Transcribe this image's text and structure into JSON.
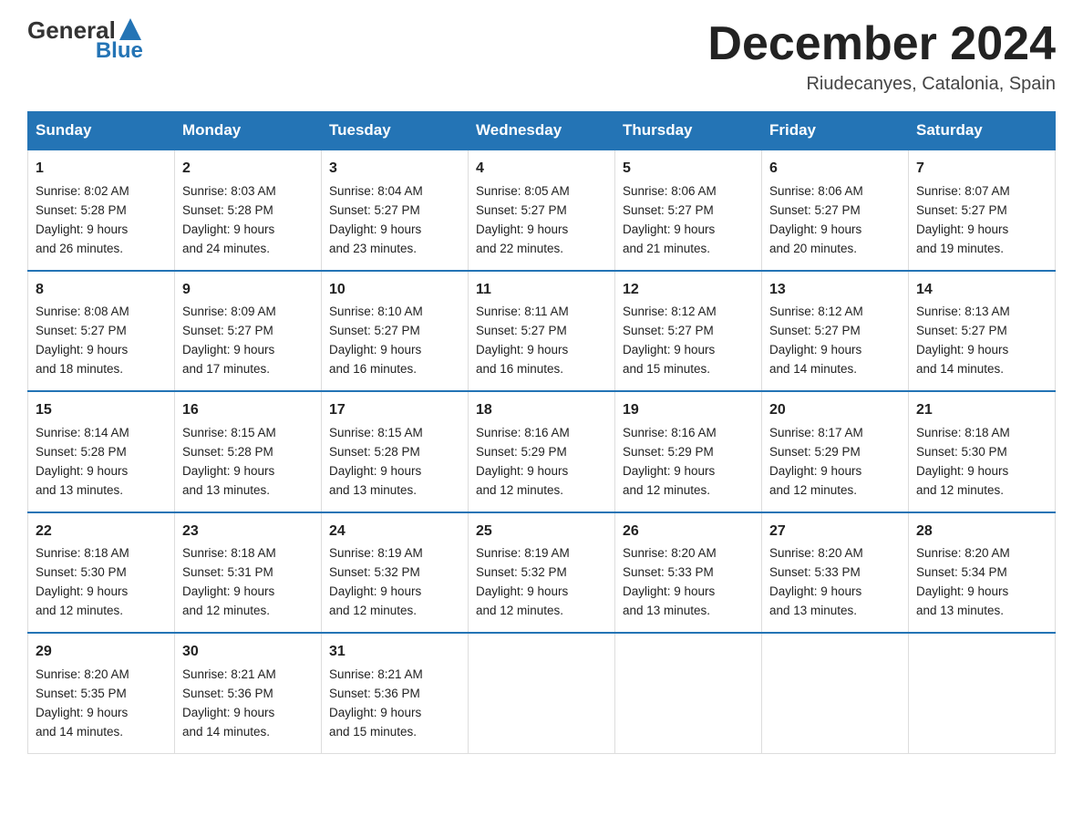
{
  "logo": {
    "general": "General",
    "blue": "Blue",
    "arrow": "▲"
  },
  "header": {
    "month": "December 2024",
    "location": "Riudecanyes, Catalonia, Spain"
  },
  "weekdays": [
    "Sunday",
    "Monday",
    "Tuesday",
    "Wednesday",
    "Thursday",
    "Friday",
    "Saturday"
  ],
  "weeks": [
    [
      {
        "day": "1",
        "sunrise": "8:02 AM",
        "sunset": "5:28 PM",
        "daylight": "9 hours and 26 minutes."
      },
      {
        "day": "2",
        "sunrise": "8:03 AM",
        "sunset": "5:28 PM",
        "daylight": "9 hours and 24 minutes."
      },
      {
        "day": "3",
        "sunrise": "8:04 AM",
        "sunset": "5:27 PM",
        "daylight": "9 hours and 23 minutes."
      },
      {
        "day": "4",
        "sunrise": "8:05 AM",
        "sunset": "5:27 PM",
        "daylight": "9 hours and 22 minutes."
      },
      {
        "day": "5",
        "sunrise": "8:06 AM",
        "sunset": "5:27 PM",
        "daylight": "9 hours and 21 minutes."
      },
      {
        "day": "6",
        "sunrise": "8:06 AM",
        "sunset": "5:27 PM",
        "daylight": "9 hours and 20 minutes."
      },
      {
        "day": "7",
        "sunrise": "8:07 AM",
        "sunset": "5:27 PM",
        "daylight": "9 hours and 19 minutes."
      }
    ],
    [
      {
        "day": "8",
        "sunrise": "8:08 AM",
        "sunset": "5:27 PM",
        "daylight": "9 hours and 18 minutes."
      },
      {
        "day": "9",
        "sunrise": "8:09 AM",
        "sunset": "5:27 PM",
        "daylight": "9 hours and 17 minutes."
      },
      {
        "day": "10",
        "sunrise": "8:10 AM",
        "sunset": "5:27 PM",
        "daylight": "9 hours and 16 minutes."
      },
      {
        "day": "11",
        "sunrise": "8:11 AM",
        "sunset": "5:27 PM",
        "daylight": "9 hours and 16 minutes."
      },
      {
        "day": "12",
        "sunrise": "8:12 AM",
        "sunset": "5:27 PM",
        "daylight": "9 hours and 15 minutes."
      },
      {
        "day": "13",
        "sunrise": "8:12 AM",
        "sunset": "5:27 PM",
        "daylight": "9 hours and 14 minutes."
      },
      {
        "day": "14",
        "sunrise": "8:13 AM",
        "sunset": "5:27 PM",
        "daylight": "9 hours and 14 minutes."
      }
    ],
    [
      {
        "day": "15",
        "sunrise": "8:14 AM",
        "sunset": "5:28 PM",
        "daylight": "9 hours and 13 minutes."
      },
      {
        "day": "16",
        "sunrise": "8:15 AM",
        "sunset": "5:28 PM",
        "daylight": "9 hours and 13 minutes."
      },
      {
        "day": "17",
        "sunrise": "8:15 AM",
        "sunset": "5:28 PM",
        "daylight": "9 hours and 13 minutes."
      },
      {
        "day": "18",
        "sunrise": "8:16 AM",
        "sunset": "5:29 PM",
        "daylight": "9 hours and 12 minutes."
      },
      {
        "day": "19",
        "sunrise": "8:16 AM",
        "sunset": "5:29 PM",
        "daylight": "9 hours and 12 minutes."
      },
      {
        "day": "20",
        "sunrise": "8:17 AM",
        "sunset": "5:29 PM",
        "daylight": "9 hours and 12 minutes."
      },
      {
        "day": "21",
        "sunrise": "8:18 AM",
        "sunset": "5:30 PM",
        "daylight": "9 hours and 12 minutes."
      }
    ],
    [
      {
        "day": "22",
        "sunrise": "8:18 AM",
        "sunset": "5:30 PM",
        "daylight": "9 hours and 12 minutes."
      },
      {
        "day": "23",
        "sunrise": "8:18 AM",
        "sunset": "5:31 PM",
        "daylight": "9 hours and 12 minutes."
      },
      {
        "day": "24",
        "sunrise": "8:19 AM",
        "sunset": "5:32 PM",
        "daylight": "9 hours and 12 minutes."
      },
      {
        "day": "25",
        "sunrise": "8:19 AM",
        "sunset": "5:32 PM",
        "daylight": "9 hours and 12 minutes."
      },
      {
        "day": "26",
        "sunrise": "8:20 AM",
        "sunset": "5:33 PM",
        "daylight": "9 hours and 13 minutes."
      },
      {
        "day": "27",
        "sunrise": "8:20 AM",
        "sunset": "5:33 PM",
        "daylight": "9 hours and 13 minutes."
      },
      {
        "day": "28",
        "sunrise": "8:20 AM",
        "sunset": "5:34 PM",
        "daylight": "9 hours and 13 minutes."
      }
    ],
    [
      {
        "day": "29",
        "sunrise": "8:20 AM",
        "sunset": "5:35 PM",
        "daylight": "9 hours and 14 minutes."
      },
      {
        "day": "30",
        "sunrise": "8:21 AM",
        "sunset": "5:36 PM",
        "daylight": "9 hours and 14 minutes."
      },
      {
        "day": "31",
        "sunrise": "8:21 AM",
        "sunset": "5:36 PM",
        "daylight": "9 hours and 15 minutes."
      },
      null,
      null,
      null,
      null
    ]
  ],
  "labels": {
    "sunrise": "Sunrise:",
    "sunset": "Sunset:",
    "daylight": "Daylight:"
  }
}
